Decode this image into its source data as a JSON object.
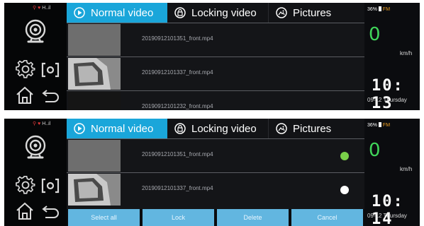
{
  "screens": [
    {
      "status": {
        "signal": "H..il"
      },
      "tabs": {
        "normal": "Normal video",
        "locking": "Locking video",
        "pictures": "Pictures"
      },
      "active_tab": "normal",
      "files": [
        {
          "name": "20190912101351_front.mp4",
          "thumb": "gray"
        },
        {
          "name": "20190912101337_front.mp4",
          "thumb": "mirror"
        },
        {
          "name": "20190912101232_front.mp4",
          "thumb": "dark"
        }
      ],
      "battery": {
        "level": "36%",
        "fm": "FM"
      },
      "speed": {
        "value": "0",
        "unit": "km/h"
      },
      "clock": {
        "time": "10: 13",
        "date": "09-12 Thursday"
      }
    },
    {
      "status": {
        "signal": "H..il"
      },
      "tabs": {
        "normal": "Normal video",
        "locking": "Locking video",
        "pictures": "Pictures"
      },
      "active_tab": "normal",
      "files": [
        {
          "name": "20190912101351_front.mp4",
          "thumb": "gray",
          "selection": "selected"
        },
        {
          "name": "20190912101337_front.mp4",
          "thumb": "mirror",
          "selection": "unselected"
        }
      ],
      "actions": {
        "select_all": "Select all",
        "lock": "Lock",
        "delete": "Delete",
        "cancel": "Cancel"
      },
      "battery": {
        "level": "36%",
        "fm": "FM"
      },
      "speed": {
        "value": "0",
        "unit": "km/h"
      },
      "clock": {
        "time": "10: 14",
        "date": "09-12 Thursday"
      }
    }
  ],
  "colors": {
    "active_tab": "#1aa6da",
    "action_button": "#62b6e0",
    "speed": "#40d65a",
    "selected_dot": "#7ad04a"
  }
}
